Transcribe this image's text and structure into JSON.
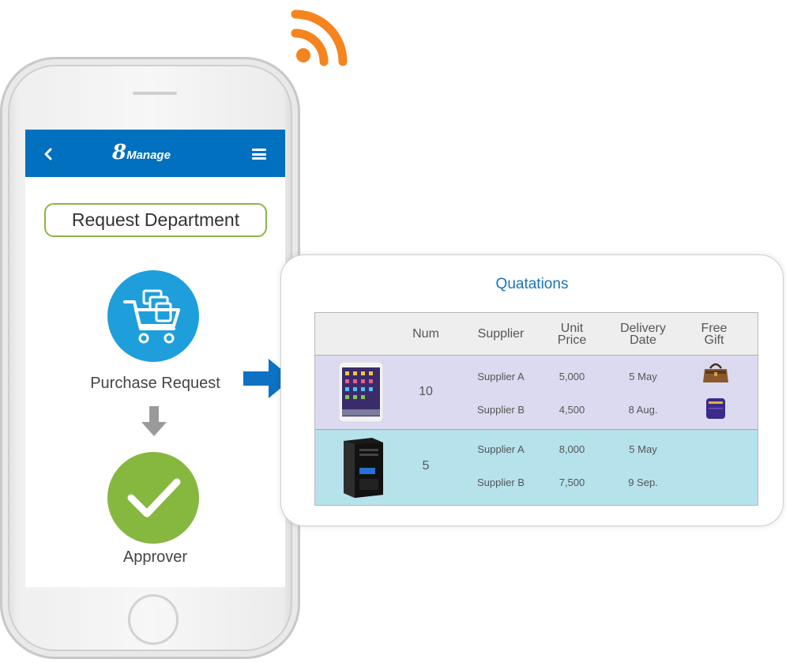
{
  "app": {
    "brand_number": "8",
    "brand_word": "Manage"
  },
  "flow": {
    "request_department": "Request Department",
    "purchase_request": "Purchase Request",
    "approver": "Approver"
  },
  "icons": {
    "signal": "wifi-signal-icon",
    "back": "chevron-left-icon",
    "menu": "hamburger-menu-icon",
    "cart": "shopping-cart-icon",
    "check": "checkmark-icon",
    "down_arrow": "arrow-down-icon",
    "right_arrow": "arrow-right-icon"
  },
  "colors": {
    "appbar": "#0070bf",
    "accent_green": "#86b83f",
    "cart_blue": "#1e9fdc",
    "signal_orange": "#f5841f",
    "row1_bg": "#dcdaf0",
    "row2_bg": "#b6e2ec"
  },
  "quotations": {
    "title": "Quatations",
    "headers": {
      "num": "Num",
      "supplier": "Supplier",
      "unit_price_1": "Unit",
      "unit_price_2": "Price",
      "delivery_1": "Delivery",
      "delivery_2": "Date",
      "gift_1": "Free",
      "gift_2": "Gift"
    },
    "items": [
      {
        "product": "tablet",
        "num": "10",
        "quotes": [
          {
            "supplier": "Supplier A",
            "price": "5,000",
            "date": "5 May",
            "gift": "brown-handbag"
          },
          {
            "supplier": "Supplier B",
            "price": "4,500",
            "date": "8 Aug.",
            "gift": "purple-bag"
          }
        ]
      },
      {
        "product": "desktop-tower",
        "num": "5",
        "quotes": [
          {
            "supplier": "Supplier A",
            "price": "8,000",
            "date": "5 May",
            "gift": ""
          },
          {
            "supplier": "Supplier B",
            "price": "7,500",
            "date": "9 Sep.",
            "gift": ""
          }
        ]
      }
    ]
  }
}
